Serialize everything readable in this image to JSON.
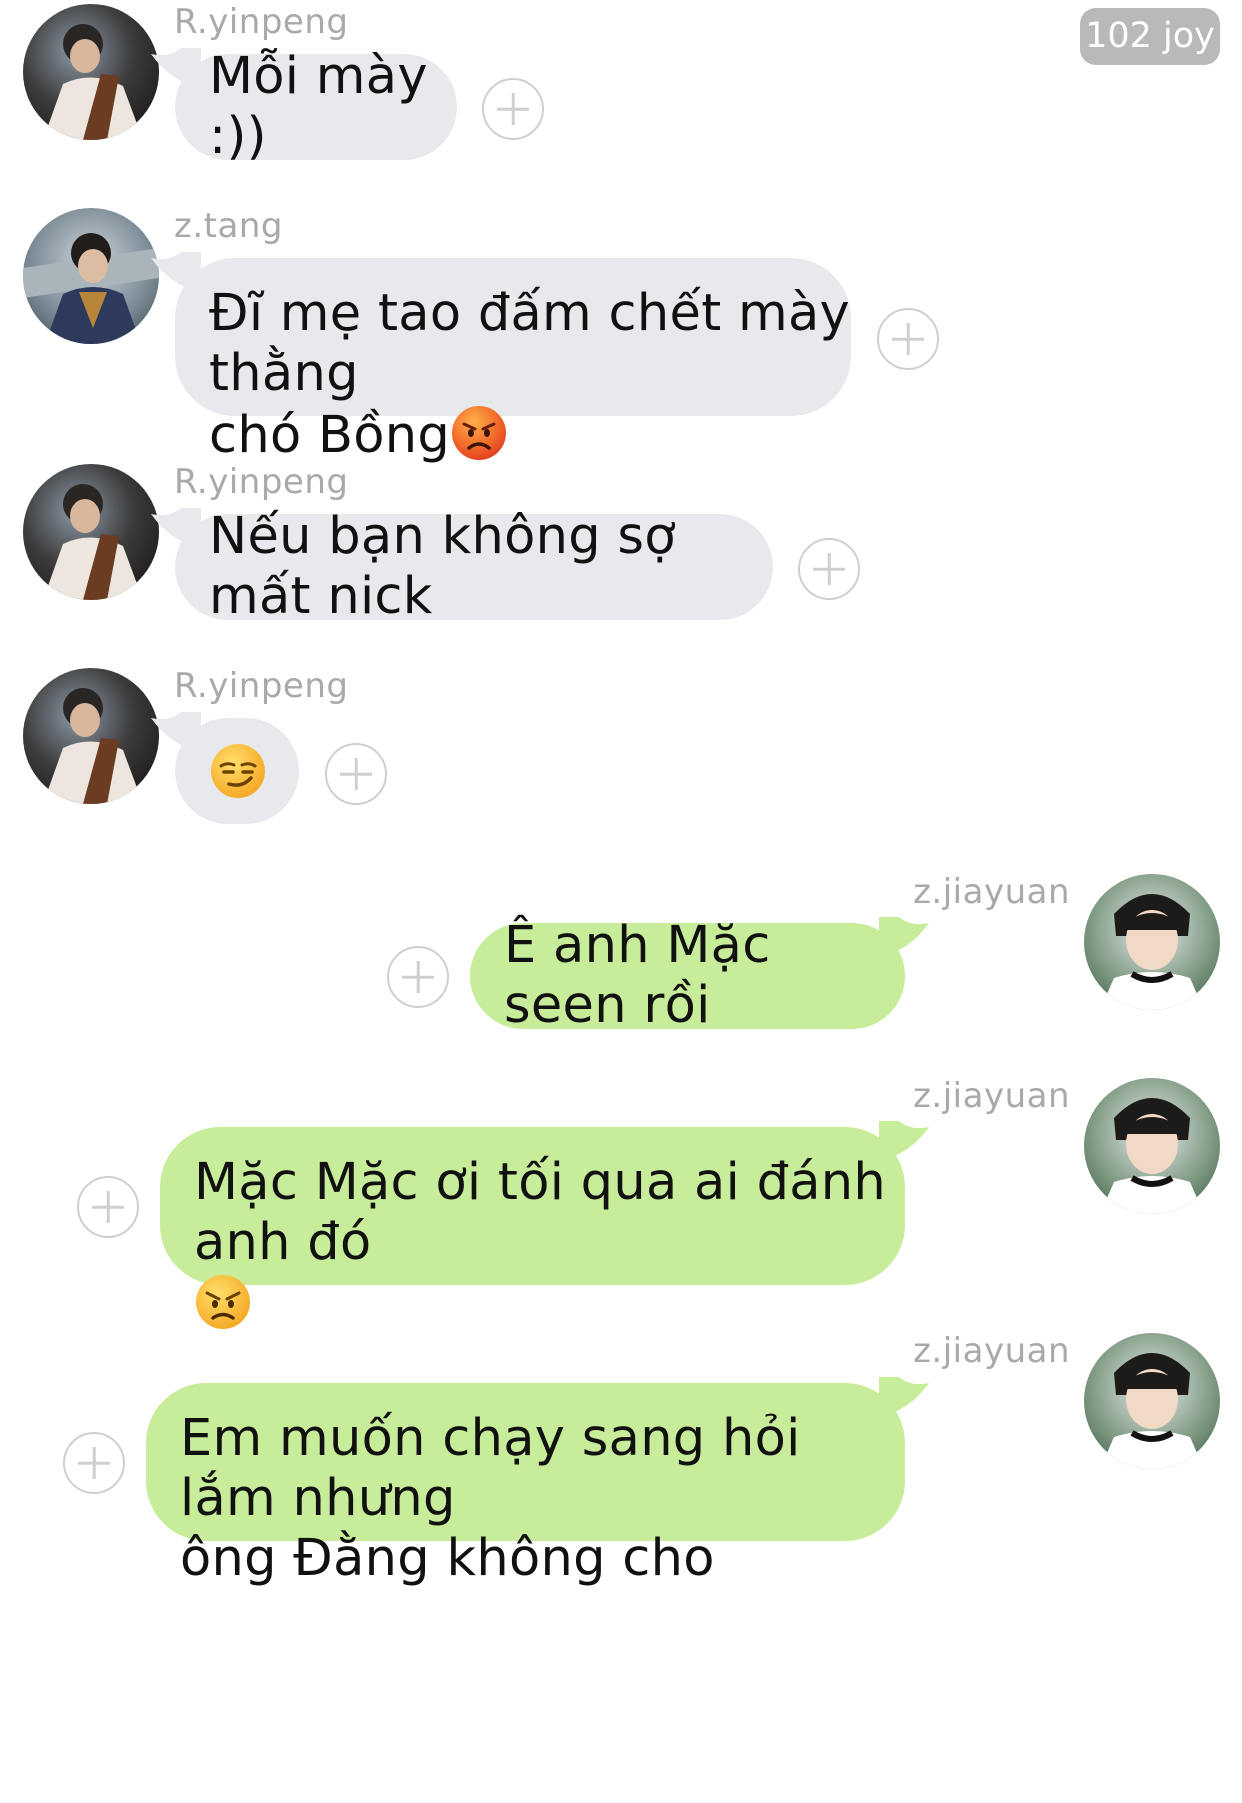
{
  "badge": {
    "label": "102 joy"
  },
  "messages": [
    {
      "sender": "R.yinpeng",
      "lines": [
        "Mỗi mày :))"
      ]
    },
    {
      "sender": "z.tang",
      "lines": [
        "Đĩ mẹ tao đấm chết mày thằng",
        "chó Bồng"
      ],
      "emoji": "pouting-face-icon"
    },
    {
      "sender": "R.yinpeng",
      "lines": [
        "Nếu bạn không sợ mất nick"
      ]
    },
    {
      "sender": "R.yinpeng",
      "emoji": "smirking-face-icon"
    },
    {
      "sender": "z.jiayuan",
      "lines": [
        "Ê anh Mặc seen rồi"
      ]
    },
    {
      "sender": "z.jiayuan",
      "lines": [
        "Mặc Mặc ơi tối qua ai đánh anh đó"
      ],
      "emoji": "angry-face-icon"
    },
    {
      "sender": "z.jiayuan",
      "lines": [
        "Em muốn chạy sang hỏi lắm nhưng",
        "ông Đằng không cho"
      ]
    }
  ],
  "colors": {
    "incoming_bubble": "#e8e9ec",
    "outgoing_bubble": "#c8ed9a",
    "sender_name": "#a9a9a9",
    "badge_bg": "#b9b9b9"
  }
}
